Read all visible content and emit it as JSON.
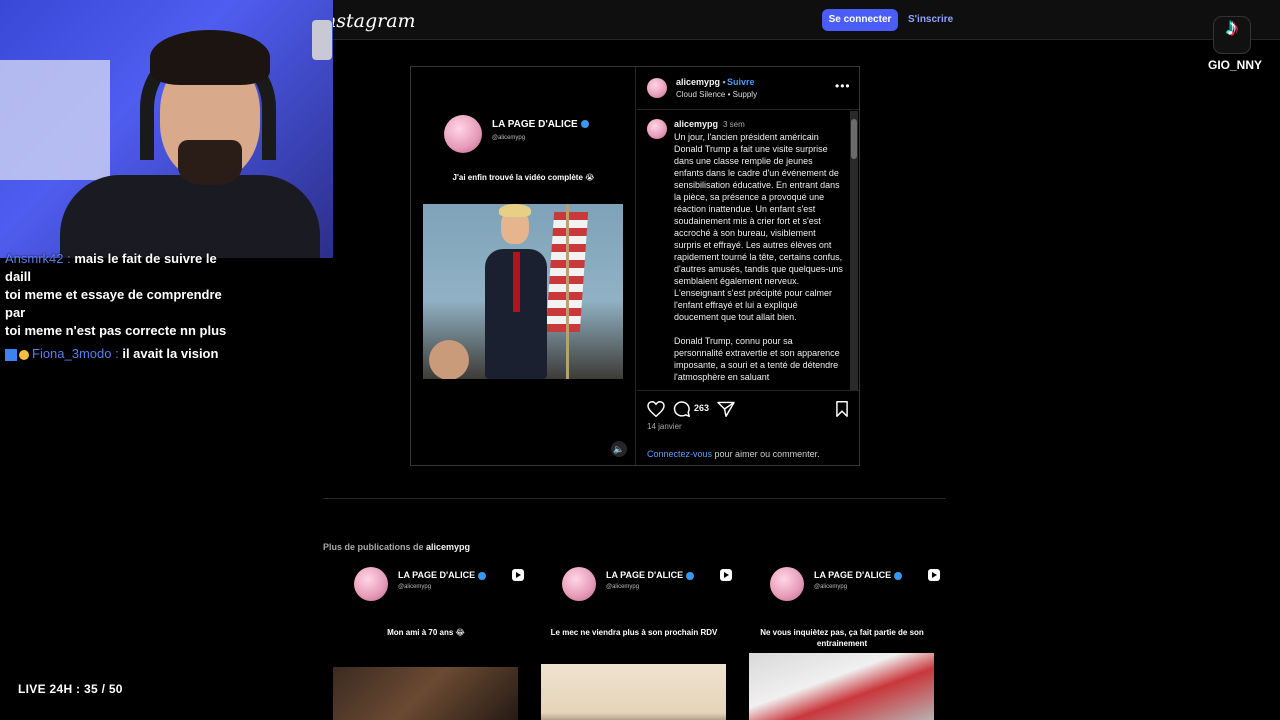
{
  "app": {
    "logo": "nstagram",
    "login_button": "Se connecter",
    "signup_link": "S'inscrire"
  },
  "post": {
    "video": {
      "page_name": "LA PAGE D'ALICE",
      "handle": "@alicemypg",
      "caption": "J'ai enfin trouvé la vidéo complète 😭",
      "mute_icon": "speaker-icon"
    },
    "header": {
      "username": "alicemypg",
      "dot": "•",
      "follow": "Suivre",
      "music": "Cloud Silence • Supply"
    },
    "caption": {
      "username": "alicemypg",
      "time": "3 sem",
      "paragraphs": [
        "Un jour, l'ancien président américain Donald Trump a fait une visite surprise dans une classe remplie de jeunes enfants dans le cadre d'un événement de sensibilisation éducative. En entrant dans la pièce, sa présence a provoqué une réaction inattendue. Un enfant s'est soudainement mis à crier fort et s'est accroché à son bureau, visiblement surpris et effrayé. Les autres élèves ont rapidement tourné la tête, certains confus, d'autres amusés, tandis que quelques-uns semblaient également nerveux. L'enseignant s'est précipité pour calmer l'enfant effrayé et lui a expliqué doucement que tout allait bien.",
        "Donald Trump, connu pour sa personnalité extravertie et son apparence imposante, a souri et a tenté de détendre l'atmosphère en saluant"
      ]
    },
    "actions": {
      "comment_count": "263",
      "date": "14 janvier",
      "login_link": "Connectez-vous",
      "login_text": " pour aimer ou commenter."
    }
  },
  "more_posts": {
    "title": "Plus de publications de ",
    "user": "alicemypg",
    "items": [
      {
        "page_name": "LA PAGE D'ALICE",
        "handle": "@alicemypg",
        "caption": "Mon ami à 70 ans 😂"
      },
      {
        "page_name": "LA PAGE D'ALICE",
        "handle": "@alicemypg",
        "caption": "Le mec ne viendra plus à son prochain RDV"
      },
      {
        "page_name": "LA PAGE D'ALICE",
        "handle": "@alicemypg",
        "caption": "Ne vous inquiètez pas, ça fait partie de son entrainement"
      }
    ]
  },
  "stream": {
    "chat": {
      "line1_user": "Ansmrk42 :",
      "line1_text": " mais le fait de suivre le daill",
      "line2_text": "toi meme et essaye de comprendre par",
      "line3_text": "toi meme n'est pas correcte nn plus",
      "line4_user": "Fiona_3modo :",
      "line4_text": " il avait la vision"
    },
    "live_counter": "LIVE 24H :  35 / 50",
    "tiktok_handle": "GIO_NNY"
  },
  "colors": {
    "accent": "#4a5df9",
    "link": "#4a9cf6",
    "background": "#000000"
  }
}
